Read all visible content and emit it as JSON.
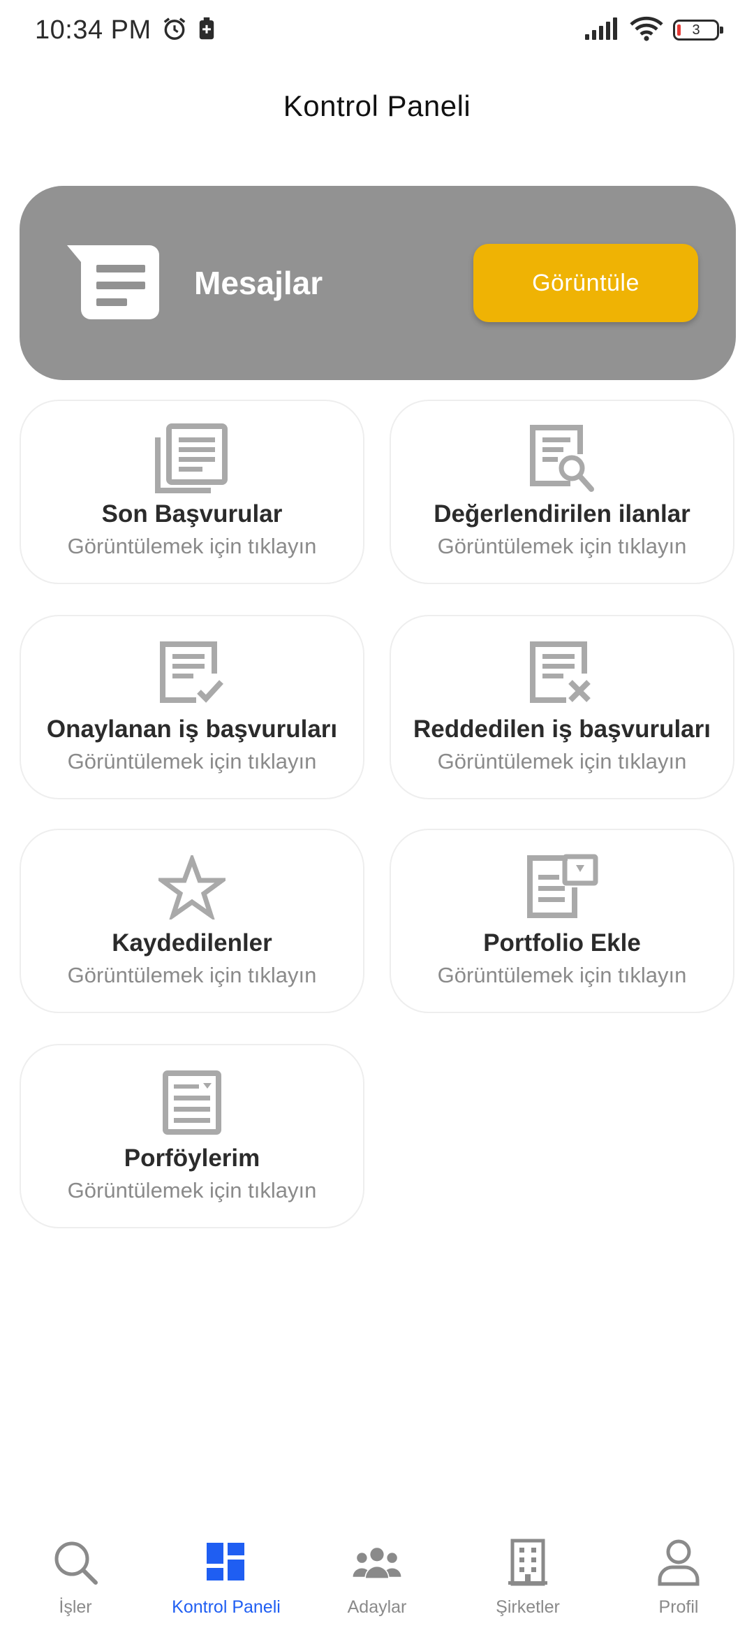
{
  "status_bar": {
    "time": "10:34 PM",
    "battery_level": "3",
    "icons": [
      "alarm-icon",
      "battery-saver-icon",
      "signal-icon",
      "wifi-icon",
      "battery-icon"
    ]
  },
  "header": {
    "title": "Kontrol Paneli"
  },
  "messages": {
    "label": "Mesajlar",
    "button_label": "Görüntüle",
    "icon": "message-icon"
  },
  "tiles": [
    {
      "title": "Son Başvurular",
      "subtitle": "Görüntülemek için tıklayın",
      "icon": "document-list-icon"
    },
    {
      "title": "Değerlendirilen ilanlar",
      "subtitle": "Görüntülemek için tıklayın",
      "icon": "document-search-icon"
    },
    {
      "title": "Onaylanan iş başvuruları",
      "subtitle": "Görüntülemek için tıklayın",
      "icon": "document-check-icon"
    },
    {
      "title": "Reddedilen iş başvuruları",
      "subtitle": "Görüntülemek için tıklayın",
      "icon": "document-x-icon"
    },
    {
      "title": "Kaydedilenler",
      "subtitle": "Görüntülemek için tıklayın",
      "icon": "star-icon"
    },
    {
      "title": "Portfolio Ekle",
      "subtitle": "Görüntülemek için tıklayın",
      "icon": "portfolio-add-icon"
    },
    {
      "title": "Porföylerim",
      "subtitle": "Görüntülemek için tıklayın",
      "icon": "portfolio-icon"
    }
  ],
  "bottom_nav": {
    "items": [
      {
        "label": "İşler",
        "icon": "search-icon",
        "active": false
      },
      {
        "label": "Kontrol Paneli",
        "icon": "dashboard-icon",
        "active": true
      },
      {
        "label": "Adaylar",
        "icon": "people-icon",
        "active": false
      },
      {
        "label": "Şirketler",
        "icon": "building-icon",
        "active": false
      },
      {
        "label": "Profil",
        "icon": "person-icon",
        "active": false
      }
    ]
  },
  "colors": {
    "accent": "#1f5ef2",
    "banner": "#929292",
    "button": "#efb304",
    "icon_gray": "#a9a9a9"
  }
}
